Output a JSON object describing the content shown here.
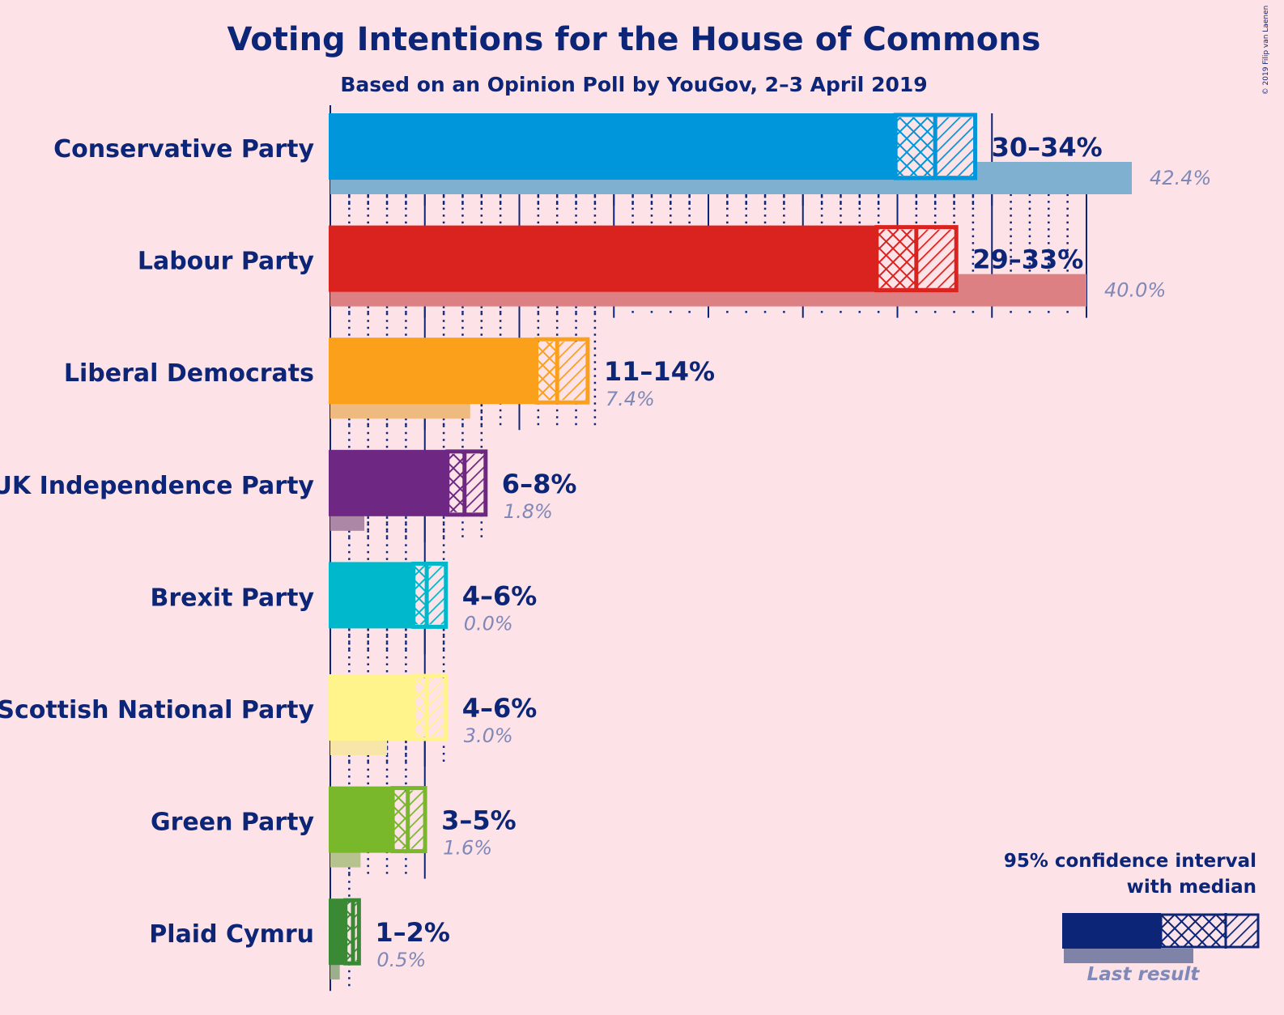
{
  "chart_data": {
    "type": "bar",
    "orientation": "horizontal",
    "title": "Voting Intentions for the House of Commons",
    "subtitle": "Based on an Opinion Poll by YouGov, 2–3 April 2019",
    "copyright": "© 2019 Filip van Laenen",
    "xlabel": "",
    "ylabel": "",
    "unit": "%",
    "grid": true,
    "grid_major_step": 5,
    "grid_minor_step": 1,
    "categories": [
      "Conservative Party",
      "Labour Party",
      "Liberal Democrats",
      "UK Independence Party",
      "Brexit Party",
      "Scottish National Party",
      "Green Party",
      "Plaid Cymru"
    ],
    "series": [
      {
        "name": "95% CI lower bound",
        "values": [
          29.9,
          28.9,
          10.9,
          6.2,
          4.4,
          4.4,
          3.3,
          0.8
        ]
      },
      {
        "name": "Median",
        "values": [
          32.0,
          31.0,
          12.0,
          7.1,
          5.1,
          5.1,
          4.1,
          1.2
        ]
      },
      {
        "name": "95% CI upper bound",
        "values": [
          34.2,
          33.2,
          13.7,
          8.3,
          6.2,
          6.2,
          5.1,
          1.6
        ]
      },
      {
        "name": "Last result",
        "values": [
          42.4,
          40.0,
          7.4,
          1.8,
          0.0,
          3.0,
          1.6,
          0.5
        ]
      }
    ],
    "range_labels": [
      "30–34%",
      "29–33%",
      "11–14%",
      "6–8%",
      "4–6%",
      "4–6%",
      "3–5%",
      "1–2%"
    ],
    "last_result_labels": [
      "42.4%",
      "40.0%",
      "7.4%",
      "1.8%",
      "0.0%",
      "3.0%",
      "1.6%",
      "0.5%"
    ],
    "grid_extent": [
      35,
      40,
      14,
      8,
      6,
      6,
      5,
      1
    ],
    "colors": [
      "#0096db",
      "#da231f",
      "#faa01a",
      "#6f2784",
      "#00b8cc",
      "#fef48b",
      "#78b82a",
      "#3a8a35"
    ],
    "last_colors": [
      "#7fb0d0",
      "#dc8083",
      "#efba80",
      "#ad87a6",
      "#7fbccc",
      "#f8e5a8",
      "#b6c38e",
      "#9cae8c"
    ],
    "legend": {
      "title_line1": "95% confidence interval",
      "title_line2": "with median",
      "last_result": "Last result",
      "position": "bottom-right",
      "color": "#0c2577",
      "last_color": "#8083a8"
    },
    "xlim": [
      0,
      45
    ]
  }
}
